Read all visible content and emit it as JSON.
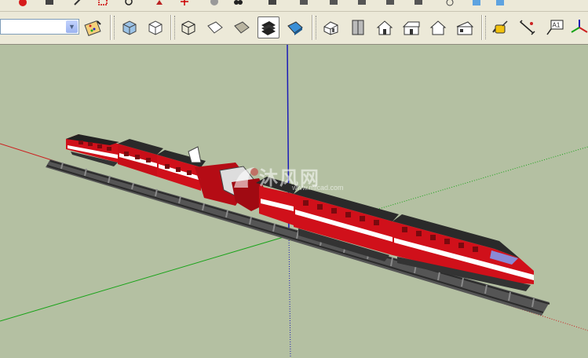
{
  "toolbar": {
    "style_combo_value": "",
    "text_tool_label": "A1",
    "groups": {
      "select": [
        "paint-bucket",
        "bucket-extra"
      ],
      "face_styles": [
        "xray",
        "wireframe",
        "hidden-line",
        "shaded",
        "shaded-texture",
        "monochrome"
      ],
      "views": [
        "iso",
        "top",
        "front",
        "right",
        "back",
        "left"
      ],
      "tools": [
        "tape-measure",
        "dimension",
        "text",
        "axes"
      ]
    }
  },
  "colors": {
    "viewport_bg": "#b4c0a2",
    "axis_red": "#cc1f1f",
    "axis_green": "#17a317",
    "axis_blue": "#1a1ab8",
    "train_red": "#d0101a"
  },
  "watermark": {
    "title": "沐风网",
    "url": "www.mfcad.com"
  }
}
